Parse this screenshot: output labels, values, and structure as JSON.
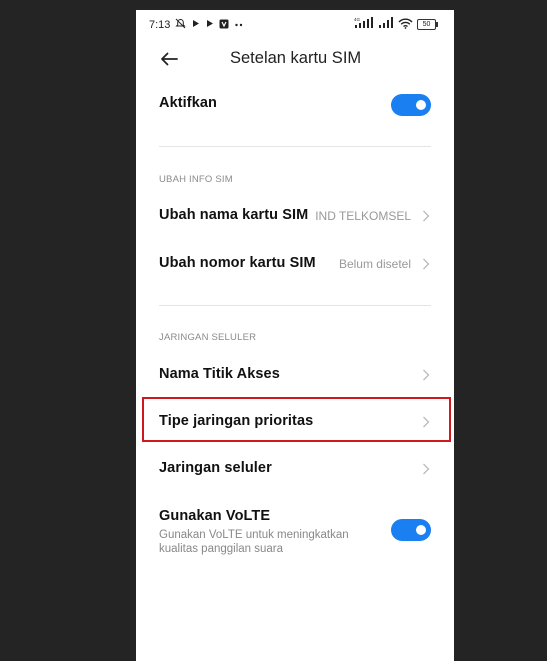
{
  "status_bar": {
    "time": "7:13",
    "battery": "50",
    "icons": [
      "mute-icon",
      "play-icon",
      "play-icon",
      "app-icon",
      "more-dots-icon",
      "signal-icon",
      "signal-icon",
      "wifi-icon",
      "battery-icon"
    ],
    "network_label": "4G"
  },
  "header": {
    "title": "Setelan kartu SIM",
    "back_icon": "arrow-left-icon"
  },
  "activate": {
    "label": "Aktifkan",
    "toggle_on": true
  },
  "sections": {
    "sim_info": {
      "title": "UBAH INFO SIM",
      "items": [
        {
          "label": "Ubah nama kartu SIM",
          "value": "IND TELKOMSEL"
        },
        {
          "label": "Ubah nomor kartu SIM",
          "value": "Belum disetel"
        }
      ]
    },
    "cellular": {
      "title": "JARINGAN SELULER",
      "items": [
        {
          "label": "Nama Titik Akses"
        },
        {
          "label": "Tipe jaringan prioritas"
        },
        {
          "label": "Jaringan seluler"
        }
      ]
    }
  },
  "volte": {
    "label": "Gunakan VoLTE",
    "description": "Gunakan VoLTE untuk meningkatkan kualitas panggilan suara",
    "toggle_on": true
  },
  "colors": {
    "accent": "#1a7ff0",
    "highlight": "#d0191f",
    "background": "#242424"
  }
}
